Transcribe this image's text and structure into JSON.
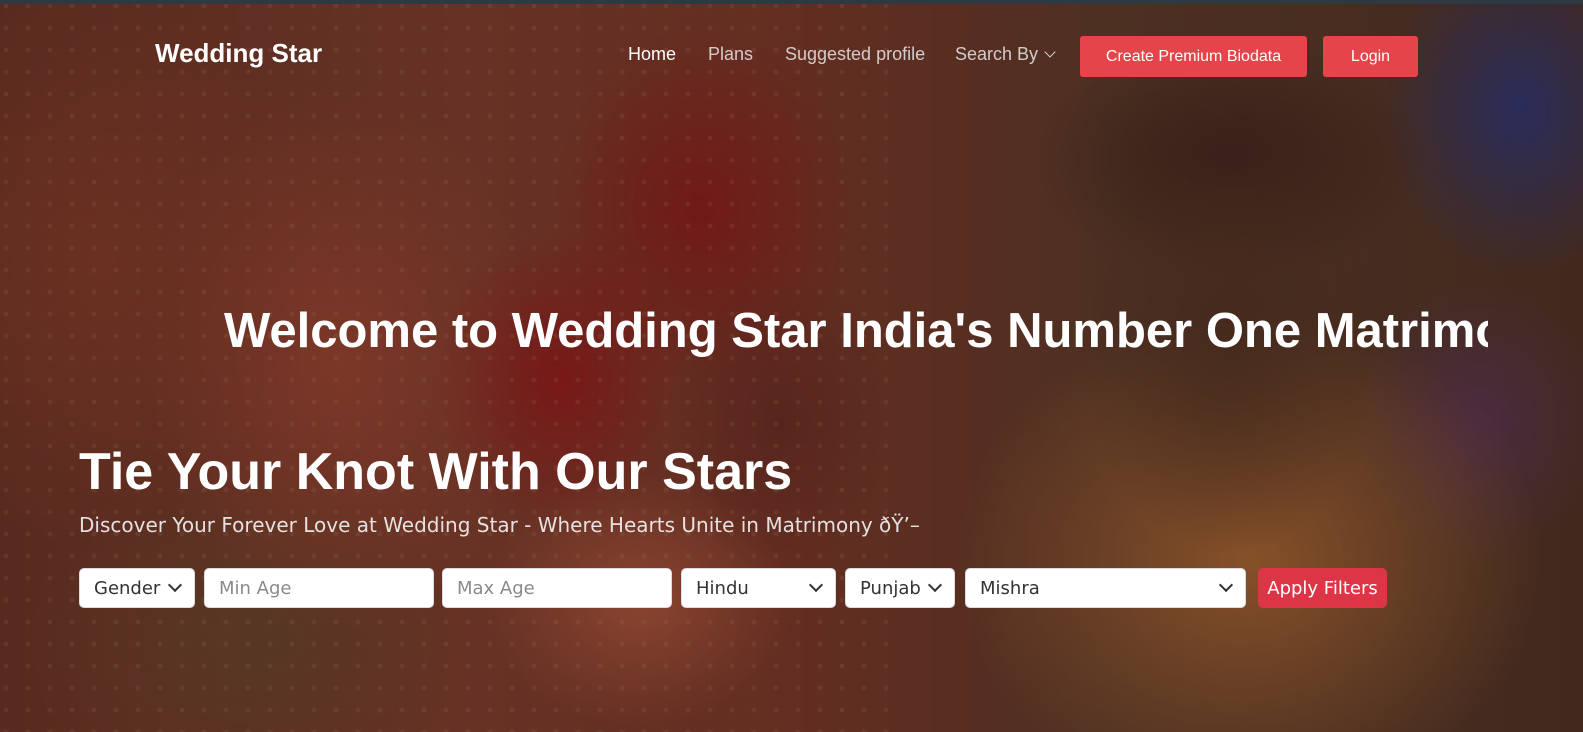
{
  "nav": {
    "brand": "Wedding Star",
    "links": [
      {
        "label": "Home",
        "active": true
      },
      {
        "label": "Plans",
        "active": false
      },
      {
        "label": "Suggested profile",
        "active": false
      },
      {
        "label": "Search By",
        "active": false,
        "icon": "chevron-down-icon"
      }
    ],
    "premium_button": "Create Premium Biodata",
    "login_button": "Login"
  },
  "hero": {
    "marquee": "Welcome to Wedding Star India's Number One Matrimo",
    "title": "Tie Your Knot With Our Stars",
    "subtitle": "Discover Your Forever Love at Wedding Star - Where Hearts Unite in Matrimony ðŸ’–"
  },
  "filters": {
    "gender": "Gender",
    "min_age_placeholder": "Min Age",
    "max_age_placeholder": "Max Age",
    "religion": "Hindu",
    "state": "Punjab",
    "caste": "Mishra",
    "apply_button": "Apply Filters"
  },
  "colors": {
    "accent_red": "#e4444a",
    "apply_red": "#dc3545",
    "text_white": "#ffffff"
  }
}
